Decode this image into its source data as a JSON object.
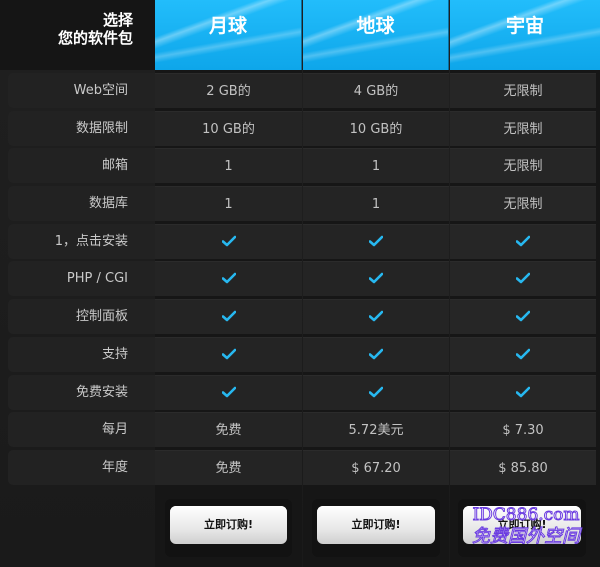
{
  "header": {
    "label_line1": "选择",
    "label_line2": "您的软件包",
    "plans": [
      "月球",
      "地球",
      "宇宙"
    ]
  },
  "features": [
    {
      "label": "Web空间",
      "values": [
        "2 GB的",
        "4 GB的",
        "无限制"
      ]
    },
    {
      "label": "数据限制",
      "values": [
        "10 GB的",
        "10 GB的",
        "无限制"
      ]
    },
    {
      "label": "邮箱",
      "values": [
        "1",
        "1",
        "无限制"
      ]
    },
    {
      "label": "数据库",
      "values": [
        "1",
        "1",
        "无限制"
      ]
    },
    {
      "label": "1，点击安装",
      "values": [
        "check",
        "check",
        "check"
      ]
    },
    {
      "label": "PHP / CGI",
      "values": [
        "check",
        "check",
        "check"
      ]
    },
    {
      "label": "控制面板",
      "values": [
        "check",
        "check",
        "check"
      ]
    },
    {
      "label": "支持",
      "values": [
        "check",
        "check",
        "check"
      ]
    },
    {
      "label": "免费安装",
      "values": [
        "check",
        "check",
        "check"
      ]
    },
    {
      "label": "每月",
      "values": [
        "免费",
        "5.72美元",
        "$ 7.30"
      ]
    },
    {
      "label": "年度",
      "values": [
        "免费",
        "$ 67.20",
        "$ 85.80"
      ]
    }
  ],
  "order_button_label": "立即订购!",
  "watermark": {
    "line1": "IDC886.com",
    "line2": "免费国外空间"
  },
  "colors": {
    "header_blue": "#1aaef2",
    "check": "#27b8f0",
    "background": "#1b1b1b"
  },
  "icons": {
    "check": "checkmark-icon"
  }
}
